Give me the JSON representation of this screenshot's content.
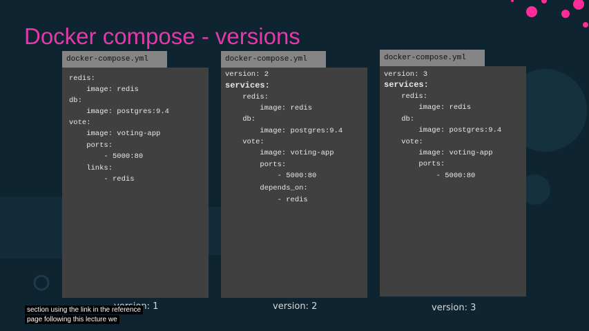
{
  "slide": {
    "title": "Docker compose - versions"
  },
  "file_tab": "docker-compose.yml",
  "panels": [
    {
      "caption": "version: 1",
      "lines": [
        "redis:",
        "    image: redis",
        "db:",
        "    image: postgres:9.4",
        "vote:",
        "    image: voting-app",
        "    ports:",
        "        - 5000:80",
        "    links:",
        "        - redis"
      ]
    },
    {
      "caption": "version: 2",
      "lines": [
        "version: 2",
        "services:",
        "    redis:",
        "        image: redis",
        "    db:",
        "        image: postgres:9.4",
        "    vote:",
        "        image: voting-app",
        "        ports:",
        "            - 5000:80",
        "        depends_on:",
        "            - redis"
      ]
    },
    {
      "caption": "version: 3",
      "lines": [
        "version: 3",
        "services:",
        "    redis:",
        "        image: redis",
        "    db:",
        "        image: postgres:9.4",
        "    vote:",
        "        image: voting-app",
        "        ports:",
        "            - 5000:80"
      ]
    }
  ],
  "subtitles": [
    "section using the link in the reference",
    "page following this lecture we"
  ],
  "colors": {
    "title": "#e23aa9",
    "background": "#0f2431",
    "panel": "#404040",
    "tab": "#858585",
    "accent_dots": "#ff2d95"
  }
}
